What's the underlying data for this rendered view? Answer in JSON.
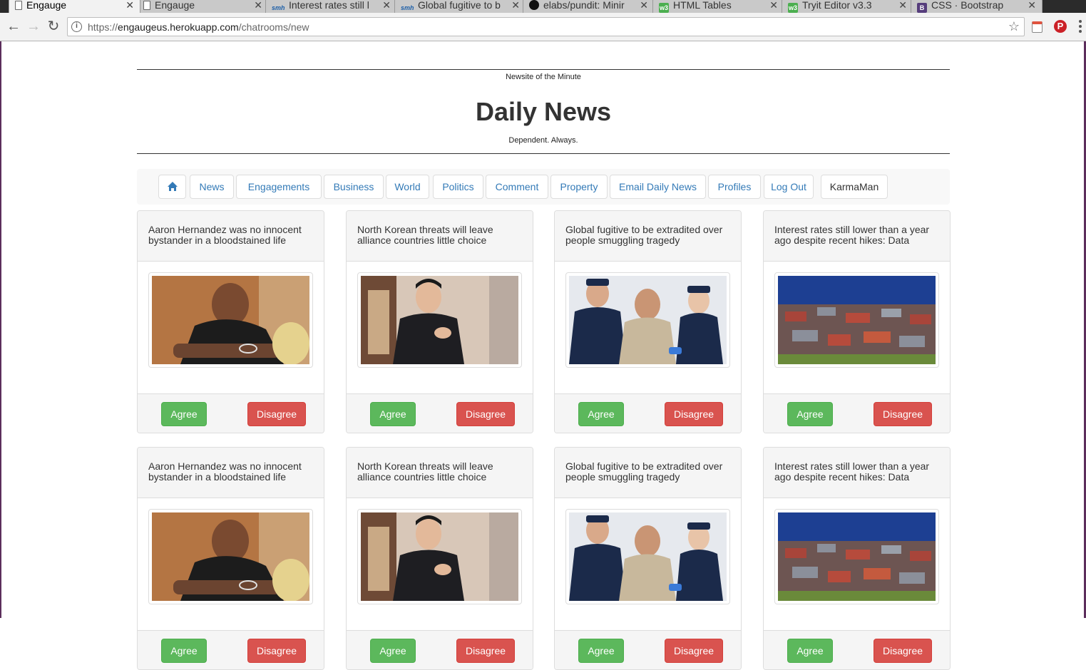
{
  "browser": {
    "tabs": [
      {
        "title": "Engauge",
        "icon": "document-icon",
        "active": true
      },
      {
        "title": "Engauge",
        "icon": "document-icon",
        "active": false
      },
      {
        "title": "Interest rates still l",
        "icon": "smh-icon",
        "active": false
      },
      {
        "title": "Global fugitive to b",
        "icon": "smh-icon",
        "active": false
      },
      {
        "title": "elabs/pundit: Minir",
        "icon": "github-icon",
        "active": false
      },
      {
        "title": "HTML Tables",
        "icon": "w3schools-icon",
        "active": false
      },
      {
        "title": "Tryit Editor v3.3",
        "icon": "w3schools-icon",
        "active": false
      },
      {
        "title": "CSS · Bootstrap",
        "icon": "bootstrap-icon",
        "active": false
      }
    ],
    "url_scheme": "https://",
    "url_host": "engaugeus.herokuapp.com",
    "url_path": "/chatrooms/new"
  },
  "masthead": {
    "kicker": "Newsite of the Minute",
    "title": "Daily News",
    "tagline": "Dependent. Always."
  },
  "nav": {
    "home_icon": "home-icon",
    "items": [
      "News",
      "Engagements",
      "Business",
      "World",
      "Politics",
      "Comment",
      "Property",
      "Email Daily News",
      "Profiles",
      "Log Out",
      "KarmaMan"
    ]
  },
  "cards": [
    {
      "headline": "Aaron Hernandez was no innocent bystander in a bloodstained life",
      "image": "courtroom-photo",
      "agree": "Agree",
      "disagree": "Disagree"
    },
    {
      "headline": "North Korean threats will leave alliance countries little choice",
      "image": "leader-applauding-photo",
      "agree": "Agree",
      "disagree": "Disagree"
    },
    {
      "headline": "Global fugitive to be extradited over people smuggling tragedy",
      "image": "police-escort-photo",
      "agree": "Agree",
      "disagree": "Disagree"
    },
    {
      "headline": "Interest rates still lower than a year ago despite recent hikes: Data",
      "image": "suburban-houses-photo",
      "agree": "Agree",
      "disagree": "Disagree"
    },
    {
      "headline": "Aaron Hernandez was no innocent bystander in a bloodstained life",
      "image": "courtroom-photo",
      "agree": "Agree",
      "disagree": "Disagree"
    },
    {
      "headline": "North Korean threats will leave alliance countries little choice",
      "image": "leader-applauding-photo",
      "agree": "Agree",
      "disagree": "Disagree"
    },
    {
      "headline": "Global fugitive to be extradited over people smuggling tragedy",
      "image": "police-escort-photo",
      "agree": "Agree",
      "disagree": "Disagree"
    },
    {
      "headline": "Interest rates still lower than a year ago despite recent hikes: Data",
      "image": "suburban-houses-photo",
      "agree": "Agree",
      "disagree": "Disagree"
    }
  ],
  "colors": {
    "link": "#337ab7",
    "agree": "#5cb85c",
    "disagree": "#d9534f"
  }
}
